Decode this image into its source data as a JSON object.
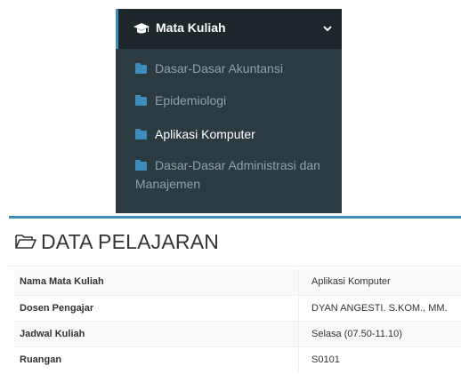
{
  "menu": {
    "title": "Mata Kuliah",
    "items": [
      {
        "label": "Dasar-Dasar Akuntansi",
        "active": false
      },
      {
        "label": "Epidemiologi",
        "active": false
      },
      {
        "label": "Aplikasi Komputer",
        "active": true
      },
      {
        "label": "Dasar-Dasar Administrasi dan Manajemen",
        "active": false
      }
    ]
  },
  "panel": {
    "title": "DATA PELAJARAN",
    "rows": [
      {
        "label": "Nama Mata Kuliah",
        "value": "Aplikasi Komputer"
      },
      {
        "label": "Dosen Pengajar",
        "value": "DYAN ANGESTI. S.KOM., MM."
      },
      {
        "label": "Jadwal Kuliah",
        "value": "Selasa (07.50-11.10)"
      },
      {
        "label": "Ruangan",
        "value": "S0101"
      }
    ]
  },
  "colors": {
    "sidebar_bg": "#222d32",
    "submenu_bg": "#2c3b41",
    "accent": "#3c8dbc",
    "submenu_text": "#8aa4af",
    "active_text": "#ffffff"
  },
  "icons": {
    "menu": "graduation-cap-icon",
    "expand": "chevron-down-icon",
    "item": "folder-icon",
    "panel": "folder-open-icon"
  }
}
